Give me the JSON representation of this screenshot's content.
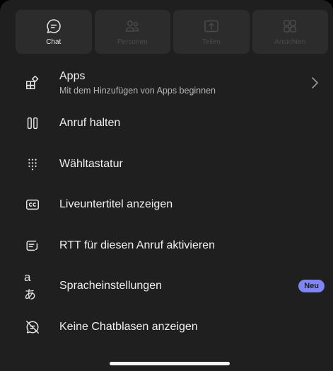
{
  "quick_actions": [
    {
      "label": "Chat",
      "icon": "chat-bubble-icon",
      "enabled": true
    },
    {
      "label": "Personen",
      "icon": "people-icon",
      "enabled": false
    },
    {
      "label": "Teilen",
      "icon": "share-screen-icon",
      "enabled": false
    },
    {
      "label": "Ansichten",
      "icon": "grid-view-icon",
      "enabled": false
    }
  ],
  "menu": {
    "apps": {
      "label": "Apps",
      "subtitle": "Mit dem Hinzufügen von Apps beginnen",
      "icon": "apps-icon"
    },
    "hold": {
      "label": "Anruf halten",
      "icon": "pause-icon"
    },
    "dialpad": {
      "label": "Wähltastatur",
      "icon": "dialpad-icon"
    },
    "captions": {
      "label": "Liveuntertitel anzeigen",
      "icon": "closed-captions-icon"
    },
    "rtt": {
      "label": "RTT für diesen Anruf aktivieren",
      "icon": "rtt-icon"
    },
    "language": {
      "label": "Spracheinstellungen",
      "icon": "language-icon",
      "icon_glyph": "aあ",
      "badge": "Neu"
    },
    "bubbles": {
      "label": "Keine Chatblasen anzeigen",
      "icon": "chat-bubble-off-icon"
    }
  },
  "colors": {
    "background": "#1f1f1f",
    "tile": "#2c2c2c",
    "badge": "#7f85f5"
  }
}
